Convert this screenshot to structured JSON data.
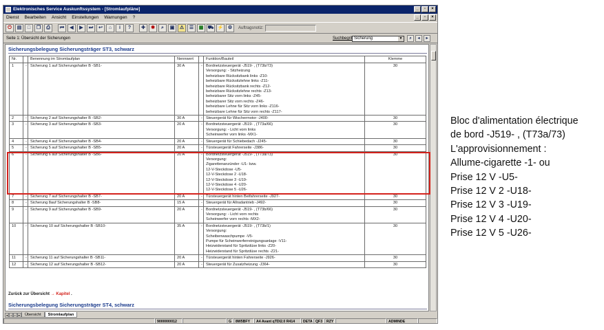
{
  "window": {
    "title": "Elektronisches Service Auskunftssystem - [Stromlaufpläne]",
    "controls": [
      "_",
      "▫",
      "×"
    ]
  },
  "menu": {
    "items": [
      "Dienst",
      "Bearbeiten",
      "Ansicht",
      "Einstellungen",
      "Warnungen",
      "?"
    ],
    "doc_controls": [
      "_",
      "▫",
      "×"
    ]
  },
  "toolbar": {
    "auftrag_label": "Auftragsnotiz:"
  },
  "infobar": {
    "page_label": "Seite 1: Übersicht der Sicherungen",
    "search_label": "Suchbegriff:",
    "search_value": "Sicherung"
  },
  "section1": {
    "title": "Sicherungsbelegung Sicherungsträger ST3, schwarz"
  },
  "table": {
    "headers": [
      "Nr.",
      "",
      "Benennung im Stromlaufplan",
      "Nennwert",
      "",
      "Funktion/Bauteil",
      "Klemme"
    ],
    "rows": [
      {
        "nr": "1",
        "dash": "-",
        "name": "Sicherung 1 auf Sicherungshalter B -SB1-",
        "value": "30 A",
        "dash2": "-",
        "func": [
          "Bordnetzsteuergerät -J519- , (T73b/73)",
          "Versorgung: - Sitzheizung",
          "beheizbare Rücksitzbank links -Z10-",
          "beheizbare Rücksitzlehne links -Z11-",
          "beheizbare Rücksitzbank rechts -Z12-",
          "beheizbare Rücksitzlehne rechts -Z13-",
          "beheizbarer Sitz vorn links -Z45-",
          "beheizbarer Sitz vorn rechts -Z46-",
          "beheizbare Lehne für Sitz vorn links -Z116-",
          "beheizbare Lehne für Sitz vorn rechts -Z117-"
        ],
        "klemme": "30"
      },
      {
        "nr": "2",
        "dash": "-",
        "name": "Sicherung 2 auf Sicherungshalter B -SB2-",
        "value": "30 A",
        "dash2": "-",
        "func": [
          "Steuergerät für Wischermotor -J400-"
        ],
        "klemme": "30"
      },
      {
        "nr": "3",
        "dash": "-",
        "name": "Sicherung 3 auf Sicherungshalter B -SB3-",
        "value": "20 A",
        "dash2": "-",
        "func": [
          "Bordnetzsteuergerät -J519- , (T73a/66)",
          "Versorgung: - Licht vorn links",
          "Scheinwerfer vorn links -MX1-"
        ],
        "klemme": "30"
      },
      {
        "nr": "4",
        "dash": "-",
        "name": "Sicherung 4 auf Sicherungshalter B -SB4-",
        "value": "20 A",
        "dash2": "-",
        "func": [
          "Steuergerät für Schiebedach -J245-"
        ],
        "klemme": "30"
      },
      {
        "nr": "5",
        "dash": "-",
        "name": "Sicherung 5 auf Sicherungshalter B -SB5-",
        "value": "20 A",
        "dash2": "-",
        "func": [
          "Türsteuergerät Fahrerseite -J386-"
        ],
        "klemme": "30"
      },
      {
        "nr": "6",
        "dash": "-",
        "name": "Sicherung 6 auf Sicherungshalter B -SB6-",
        "value": "20 A",
        "dash2": "-",
        "func": [
          "Bordnetzsteuergerät -J519- , (T73a/73)",
          "Versorgung:",
          "Zigarettenanzünder -U1- bzw.",
          "12-V-Steckdose -U5-",
          "12-V-Steckdose 2 -U18-",
          "12-V-Steckdose 3 -U19-",
          "12-V-Steckdose 4 -U20-",
          "12-V-Steckdose 5 -U26-"
        ],
        "klemme": "30"
      },
      {
        "nr": "7",
        "dash": "-",
        "name": "Sicherung 7 auf Sicherungshalter B -SB7-",
        "value": "20 A",
        "dash2": "-",
        "func": [
          "Türsteuergerät hinten Beifahrerseite -J927-"
        ],
        "klemme": "30"
      },
      {
        "nr": "8",
        "dash": "-",
        "name": "Sicherung 8auf Sicherungshalter B -SB8-",
        "value": "15 A",
        "dash2": "-",
        "func": [
          "Steuergerät für Allradantrieb -J492-"
        ],
        "klemme": "30"
      },
      {
        "nr": "9",
        "dash": "-",
        "name": "Sicherung 9 auf Sicherungshalter B -SB9-",
        "value": "20 A",
        "dash2": "-",
        "func": [
          "Bordnetzsteuergerät -J519- , (T73b/66)",
          "Versorgung: - Licht vorn rechts",
          "Scheinwerfer vorn rechts -MX2-"
        ],
        "klemme": "30"
      },
      {
        "nr": "10",
        "dash": "-",
        "name": "Sicherung 10 auf Sicherungshalter B -SB10-",
        "value": "35 A",
        "dash2": "-",
        "func": [
          "Bordnetzsteuergerät -J519- , (T73b/1)",
          "Versorgung:",
          "Scheibenwaschpumpe -V5-",
          "Pumpe für Scheinwerferreinigungsanlage -V11-",
          "Heizwiderstand für Spritzdüse links -Z20-",
          "Heizwiderstand für Spritzdüse rechts -Z21-"
        ],
        "klemme": "30"
      },
      {
        "nr": "11",
        "dash": "-",
        "name": "Sicherung 11 auf Sicherungshalter B -SB11-",
        "value": "20 A",
        "dash2": "-",
        "func": [
          "Türsteuergerät hinten Fahrerseite -J926-"
        ],
        "klemme": "30"
      },
      {
        "nr": "12",
        "dash": "-",
        "name": "Sicherung 12 auf Sicherungshalter B -SB12-",
        "value": "20 A",
        "dash2": "-",
        "func": [
          "Steuergerät für Zusatzheizung -J364-"
        ],
        "klemme": "30"
      }
    ]
  },
  "back_link": {
    "text": "Zurück zur Übersicht",
    "arrow": "→",
    "kapitel": "Kapitel",
    "end": "."
  },
  "section2": {
    "title": "Sicherungsbelegung Sicherungsträger ST4, schwarz"
  },
  "tabs": [
    "Übersicht",
    "Stromlaufplan"
  ],
  "status": [
    "",
    "9000000012",
    "",
    "G",
    "8W5BFY",
    "A4 Avant qTDI2.0 R414",
    "DETA",
    "QF3",
    "RZY",
    "",
    "ADMINDE",
    ""
  ],
  "annotation": {
    "lines": [
      "Bloc d'alimentation électrique",
      "de bord -J519- , (T73a/73)",
      "L'approvisionnement :",
      "Allume-cigarette -1- ou",
      "Prise 12 V -U5-",
      "Prise 12 V 2 -U18-",
      "Prise 12 V 3 -U19-",
      "Prise 12 V 4 -U20-",
      "Prise 12 V 5 -U26-"
    ]
  },
  "colors": {
    "title_bar": "#0a246a",
    "section_title": "#1a3a8c",
    "highlight": "#d4221c"
  }
}
